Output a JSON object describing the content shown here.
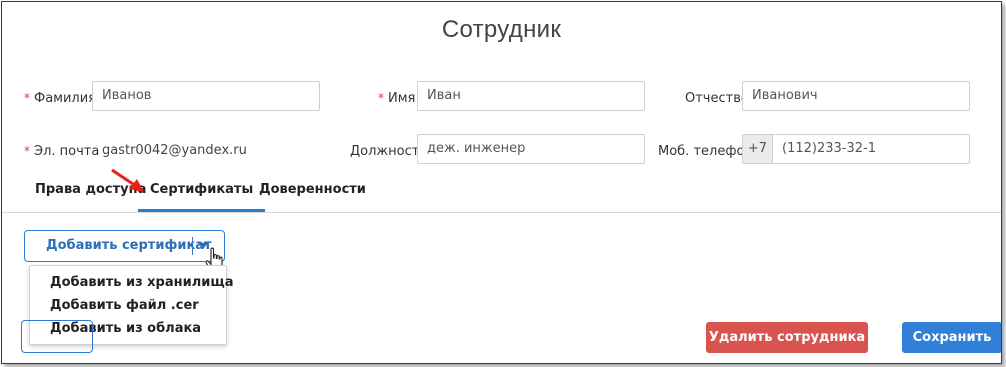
{
  "form": {
    "title": "Сотрудник",
    "required_mark": "*",
    "last_name": {
      "label": "Фамилия",
      "value": "Иванов"
    },
    "first_name": {
      "label": "Имя",
      "value": "Иван"
    },
    "patronymic": {
      "label": "Отчество",
      "value": "Иванович"
    },
    "email": {
      "label": "Эл. почта",
      "value": "gastr0042@yandex.ru"
    },
    "position": {
      "label": "Должность",
      "value": "деж. инженер"
    },
    "phone": {
      "label": "Моб. телефон",
      "prefix": "+7",
      "value": "(112)233-32-1"
    }
  },
  "tabs": [
    {
      "label": "Права доступа",
      "active": false
    },
    {
      "label": "Сертификаты",
      "active": true
    },
    {
      "label": "Доверенности",
      "active": false
    }
  ],
  "certificates": {
    "add_button_label": "Добавить сертификат",
    "menu": [
      "Добавить из хранилища",
      "Добавить файл .cer",
      "Добавить из облака"
    ]
  },
  "actions": {
    "delete_label": "Удалить сотрудника",
    "save_label": "Сохранить"
  },
  "colors": {
    "accent": "#2b7bd1",
    "danger": "#d9534f",
    "required": "#d9383a",
    "annotation_arrow": "#e8201c"
  },
  "icons": {
    "dropdown": "caret-down-icon",
    "cursor": "hand-pointer-icon",
    "annotation": "red-arrow-icon"
  }
}
